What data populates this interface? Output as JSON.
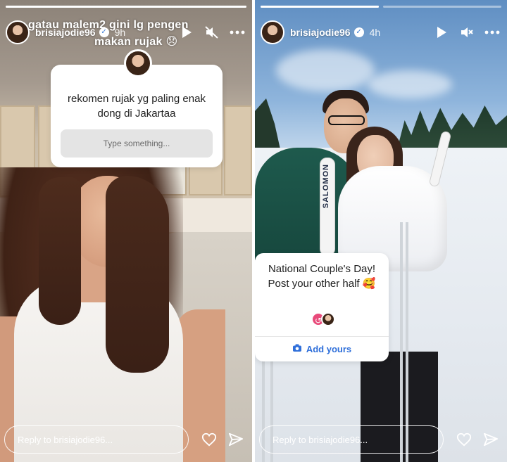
{
  "left_story": {
    "username": "brisiajodie96",
    "time": "9h",
    "caption_line1": "gatau malem2 gini lg pengen",
    "caption_line2": "makan rujak",
    "caption_emoji": "😞",
    "question_sticker": {
      "question": "rekomen rujak yg paling enak dong di Jakartaa",
      "placeholder": "Type something..."
    },
    "reply_placeholder": "Reply to brisiajodie96...",
    "progress": 1.0
  },
  "right_story": {
    "username": "brisiajodie96",
    "time": "4h",
    "ski_brand": "SALOMON",
    "add_yours_sticker": {
      "prompt": "National Couple's Day! Post your other half 🥰",
      "button_label": "Add yours"
    },
    "reply_placeholder": "Reply to brisiajodie96...",
    "progress": 0.5
  },
  "icons": {
    "play": "play-icon",
    "mute": "mute-icon",
    "more": "more-icon",
    "like": "heart-icon",
    "share": "send-icon",
    "camera": "camera-icon",
    "verified": "verified-badge-icon"
  },
  "colors": {
    "accent_blue": "#2f6fda",
    "verified_blue": "#3a7bd5"
  }
}
